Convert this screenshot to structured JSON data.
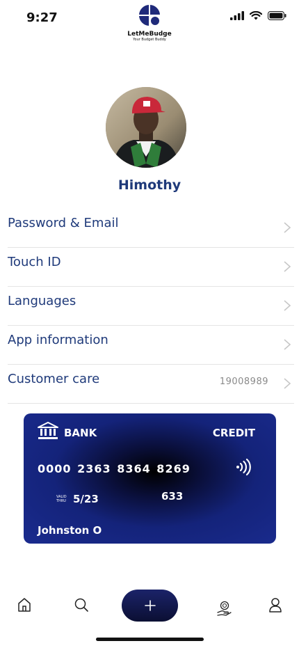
{
  "status_bar": {
    "time": "9:27"
  },
  "header": {
    "app_name": "LetMeBudge",
    "tagline": "Your Budget Buddy"
  },
  "profile": {
    "name": "Himothy"
  },
  "menu": {
    "items": [
      {
        "label": "Password & Email",
        "value": ""
      },
      {
        "label": "Touch ID",
        "value": ""
      },
      {
        "label": "Languages",
        "value": ""
      },
      {
        "label": "App information",
        "value": ""
      },
      {
        "label": "Customer care",
        "value": "19008989"
      }
    ]
  },
  "card": {
    "bank": "BANK",
    "type": "CREDIT",
    "number": "0000  2363  8364  8269",
    "valid_label": "VALID THRU",
    "expiry": "5/23",
    "cvv": "633",
    "holder": "Johnston O"
  },
  "nav": {
    "items": [
      "home-icon",
      "search-icon",
      "add-icon",
      "savings-icon",
      "profile-icon"
    ]
  },
  "colors": {
    "brand": "#1f3a7a",
    "card": "#1a2b8e",
    "add_button": "#141a50"
  }
}
